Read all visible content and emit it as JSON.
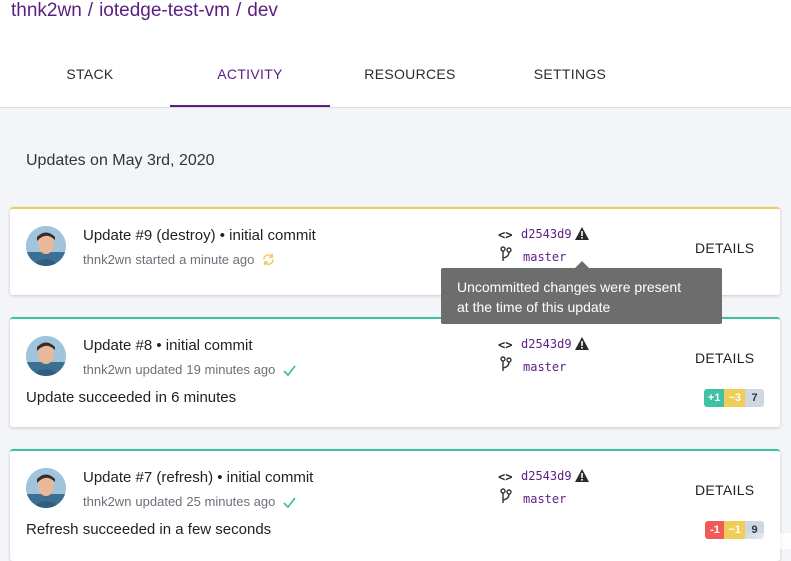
{
  "breadcrumb": {
    "org": "thnk2wn",
    "project": "iotedge-test-vm",
    "stack": "dev",
    "separator": "/"
  },
  "tabs": [
    {
      "label": "STACK",
      "active": false
    },
    {
      "label": "ACTIVITY",
      "active": true
    },
    {
      "label": "RESOURCES",
      "active": false
    },
    {
      "label": "SETTINGS",
      "active": false
    }
  ],
  "date_heading": "Updates on May 3rd, 2020",
  "colors": {
    "accent": "#5b1e84",
    "success": "#3fc1a3",
    "in_progress": "#f0cc58",
    "delete": "#f05a5a"
  },
  "updates": [
    {
      "title": "Update #9 (destroy) • initial commit",
      "user": "thnk2wn",
      "verb": "started",
      "time": "a minute ago",
      "status_icon": "spinner-icon",
      "commit_icon": "code-icon",
      "code_glyph": "<>",
      "commit": "d2543d9",
      "commit_warning_icon": "warning-icon",
      "branch": "master",
      "details_label": "DETAILS"
    },
    {
      "title": "Update #8 • initial commit",
      "user": "thnk2wn",
      "verb": "updated",
      "time": "19 minutes ago",
      "status_icon": "check-icon",
      "code_glyph": "<>",
      "commit": "d2543d9",
      "branch": "master",
      "details_label": "DETAILS",
      "result_prefix": "Update ",
      "result_word": "succeeded",
      "result_suffix": " in 6 minutes",
      "changes": {
        "create": "+1",
        "update": "~3",
        "same": "7"
      }
    },
    {
      "title": "Update #7 (refresh) • initial commit",
      "user": "thnk2wn",
      "verb": "updated",
      "time": "25 minutes ago",
      "status_icon": "check-icon",
      "code_glyph": "<>",
      "commit": "d2543d9",
      "branch": "master",
      "details_label": "DETAILS",
      "result_prefix": "Refresh ",
      "result_word": "succeeded",
      "result_suffix": " in a few seconds",
      "changes": {
        "delete": "-1",
        "update": "~1",
        "same": "9"
      }
    }
  ],
  "tooltip": {
    "line1": "Uncommitted changes were present",
    "line2": "at the time of this update"
  }
}
